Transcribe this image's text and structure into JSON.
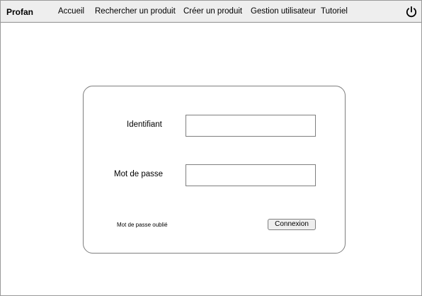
{
  "navbar": {
    "brand": "Profan",
    "items": [
      {
        "label": "Accueil"
      },
      {
        "label": "Rechercher un produit"
      },
      {
        "label": "Créer un produit"
      },
      {
        "label": "Gestion utilisateur"
      },
      {
        "label": "Tutoriel"
      }
    ],
    "power_icon": "power-icon"
  },
  "login": {
    "username_label": "Identifiant",
    "username_value": "",
    "password_label": "Mot de passe",
    "password_value": "",
    "forgot_link": "Mot de passe oublié",
    "submit_label": "Connexion"
  }
}
